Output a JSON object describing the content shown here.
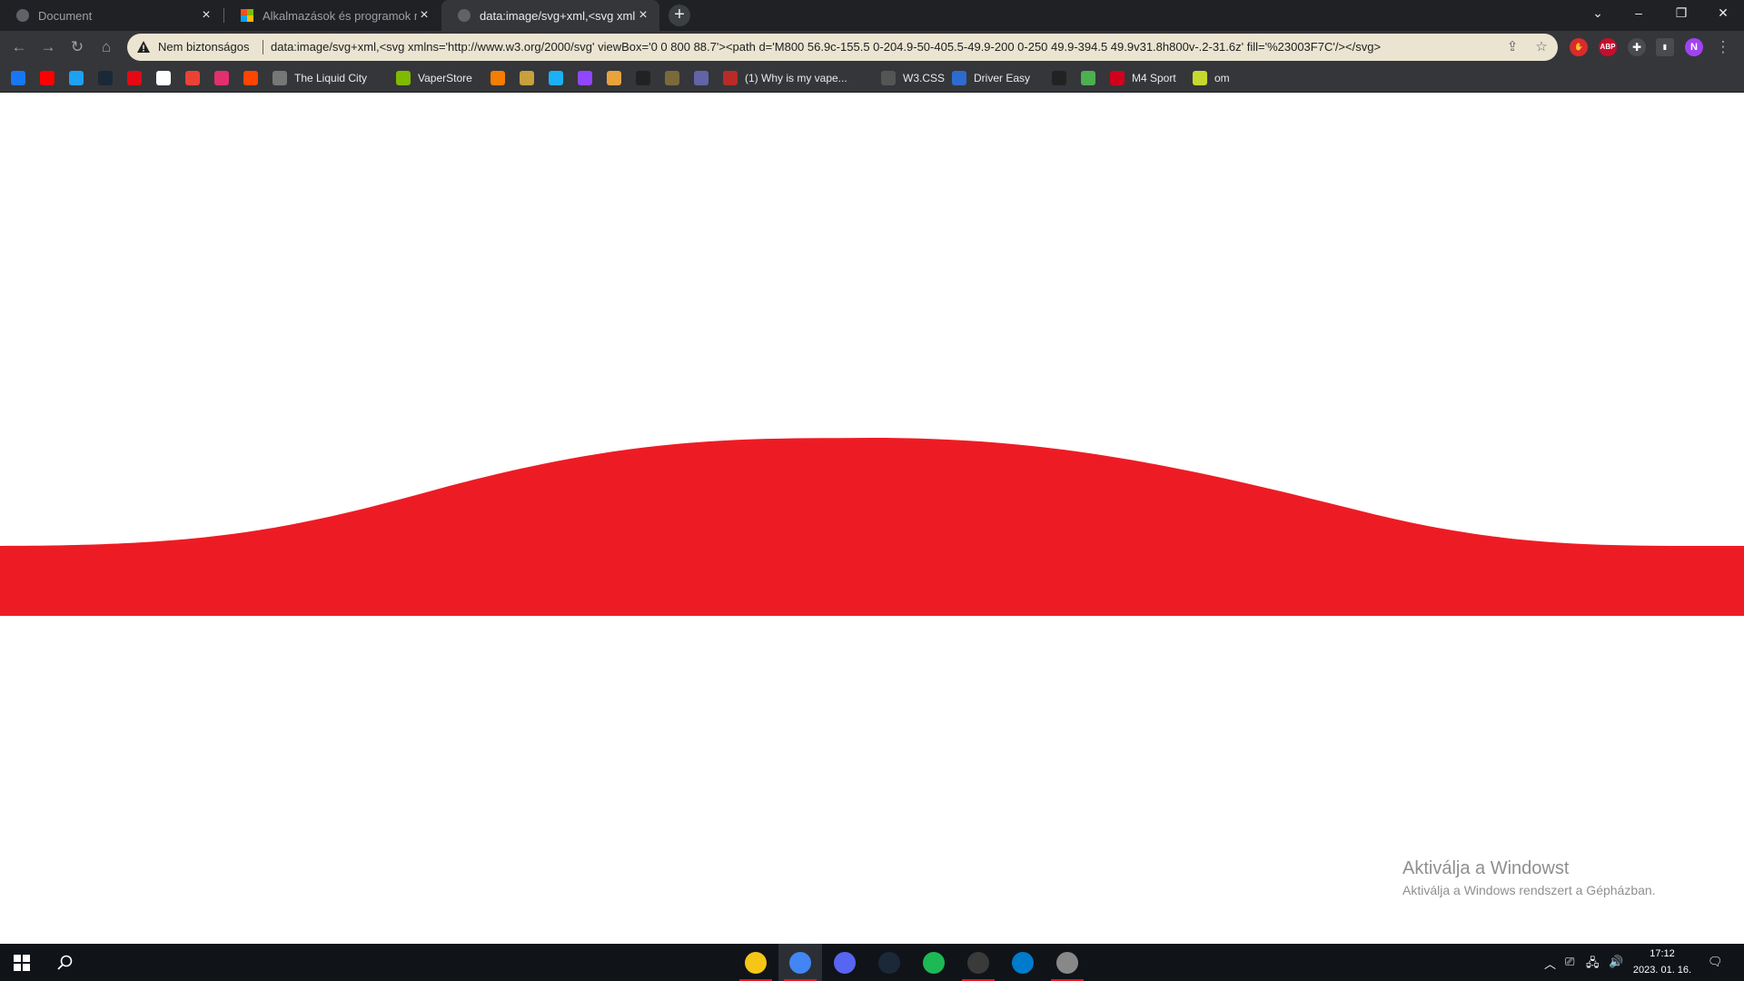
{
  "tabs": [
    {
      "title": "Document",
      "active": false
    },
    {
      "title": "Alkalmazások és programok meg",
      "active": false
    },
    {
      "title": "data:image/svg+xml,<svg xmlns",
      "active": true
    }
  ],
  "omnibox": {
    "security_label": "Nem biztonságos",
    "url": "data:image/svg+xml,<svg xmlns='http://www.w3.org/2000/svg' viewBox='0 0 800 88.7'><path d='M800 56.9c-155.5 0-204.9-50-405.5-49.9-200 0-250 49.9-394.5 49.9v31.8h800v-.2-31.6z' fill='%23003F7C'/></svg>"
  },
  "extensions": {
    "abp_label": "ABP",
    "profile_initial": "N"
  },
  "bookmarks": [
    {
      "label": "",
      "color": "#1877f2",
      "icon": "facebook-icon"
    },
    {
      "label": "",
      "color": "#ff0000",
      "icon": "youtube-icon"
    },
    {
      "label": "",
      "color": "#1da1f2",
      "icon": "twitter-icon"
    },
    {
      "label": "",
      "color": "#1b2838",
      "icon": "steam-icon"
    },
    {
      "label": "",
      "color": "#e50914",
      "icon": "netflix-icon"
    },
    {
      "label": "",
      "color": "#ffffff",
      "icon": "google-icon"
    },
    {
      "label": "",
      "color": "#ea4335",
      "icon": "gmail-icon"
    },
    {
      "label": "",
      "color": "#e1306c",
      "icon": "instagram-icon"
    },
    {
      "label": "",
      "color": "#ff4500",
      "icon": "reddit-icon"
    },
    {
      "label": "The Liquid City",
      "color": "#777777",
      "icon": "globe-icon"
    },
    {
      "label": "VaperStore",
      "color": "#7fba00",
      "icon": "store-icon"
    },
    {
      "label": "",
      "color": "#f57d00",
      "icon": "blogger-icon"
    },
    {
      "label": "",
      "color": "#c8a03c",
      "icon": "sb-icon"
    },
    {
      "label": "",
      "color": "#1cb0f6",
      "icon": "k-icon"
    },
    {
      "label": "",
      "color": "#9146ff",
      "icon": "twitch-icon"
    },
    {
      "label": "",
      "color": "#e8a33d",
      "icon": "character-icon"
    },
    {
      "label": "",
      "color": "#222222",
      "icon": "square-icon"
    },
    {
      "label": "",
      "color": "#7a6a3a",
      "icon": "map-icon"
    },
    {
      "label": "",
      "color": "#6264a7",
      "icon": "teams-icon"
    },
    {
      "label": "(1) Why is my vape...",
      "color": "#b92b27",
      "icon": "quora-icon"
    },
    {
      "label": "W3.CSS",
      "color": "#555555",
      "icon": "w3-icon"
    },
    {
      "label": "Driver Easy",
      "color": "#2d6bd0",
      "icon": "driver-easy-icon"
    },
    {
      "label": "",
      "color": "#222222",
      "icon": "square-icon"
    },
    {
      "label": "",
      "color": "#4caf50",
      "icon": "colorful-icon"
    },
    {
      "label": "M4 Sport",
      "color": "#d0021b",
      "icon": "m4-icon"
    },
    {
      "label": "om",
      "color": "#c6d82e",
      "icon": "om-icon"
    }
  ],
  "content": {
    "wave_color": "#ED1C24"
  },
  "watermark": {
    "line1": "Aktiválja a Windowst",
    "line2": "Aktiválja a Windows rendszert a Gépházban."
  },
  "taskbar": {
    "apps": [
      {
        "name": "file-explorer",
        "color": "#f5c518",
        "running": true,
        "active": false
      },
      {
        "name": "chrome",
        "color": "#4285f4",
        "running": true,
        "active": true
      },
      {
        "name": "discord",
        "color": "#5865f2",
        "running": false,
        "active": false
      },
      {
        "name": "steam",
        "color": "#1b2838",
        "running": false,
        "active": false
      },
      {
        "name": "spotify",
        "color": "#1db954",
        "running": false,
        "active": false
      },
      {
        "name": "app-installer",
        "color": "#3a3a3a",
        "running": true,
        "active": false
      },
      {
        "name": "vscode",
        "color": "#007acc",
        "running": false,
        "active": false
      },
      {
        "name": "paint",
        "color": "#888888",
        "running": true,
        "active": false
      }
    ],
    "clock_time": "17:12",
    "clock_date": "2023. 01. 16."
  }
}
